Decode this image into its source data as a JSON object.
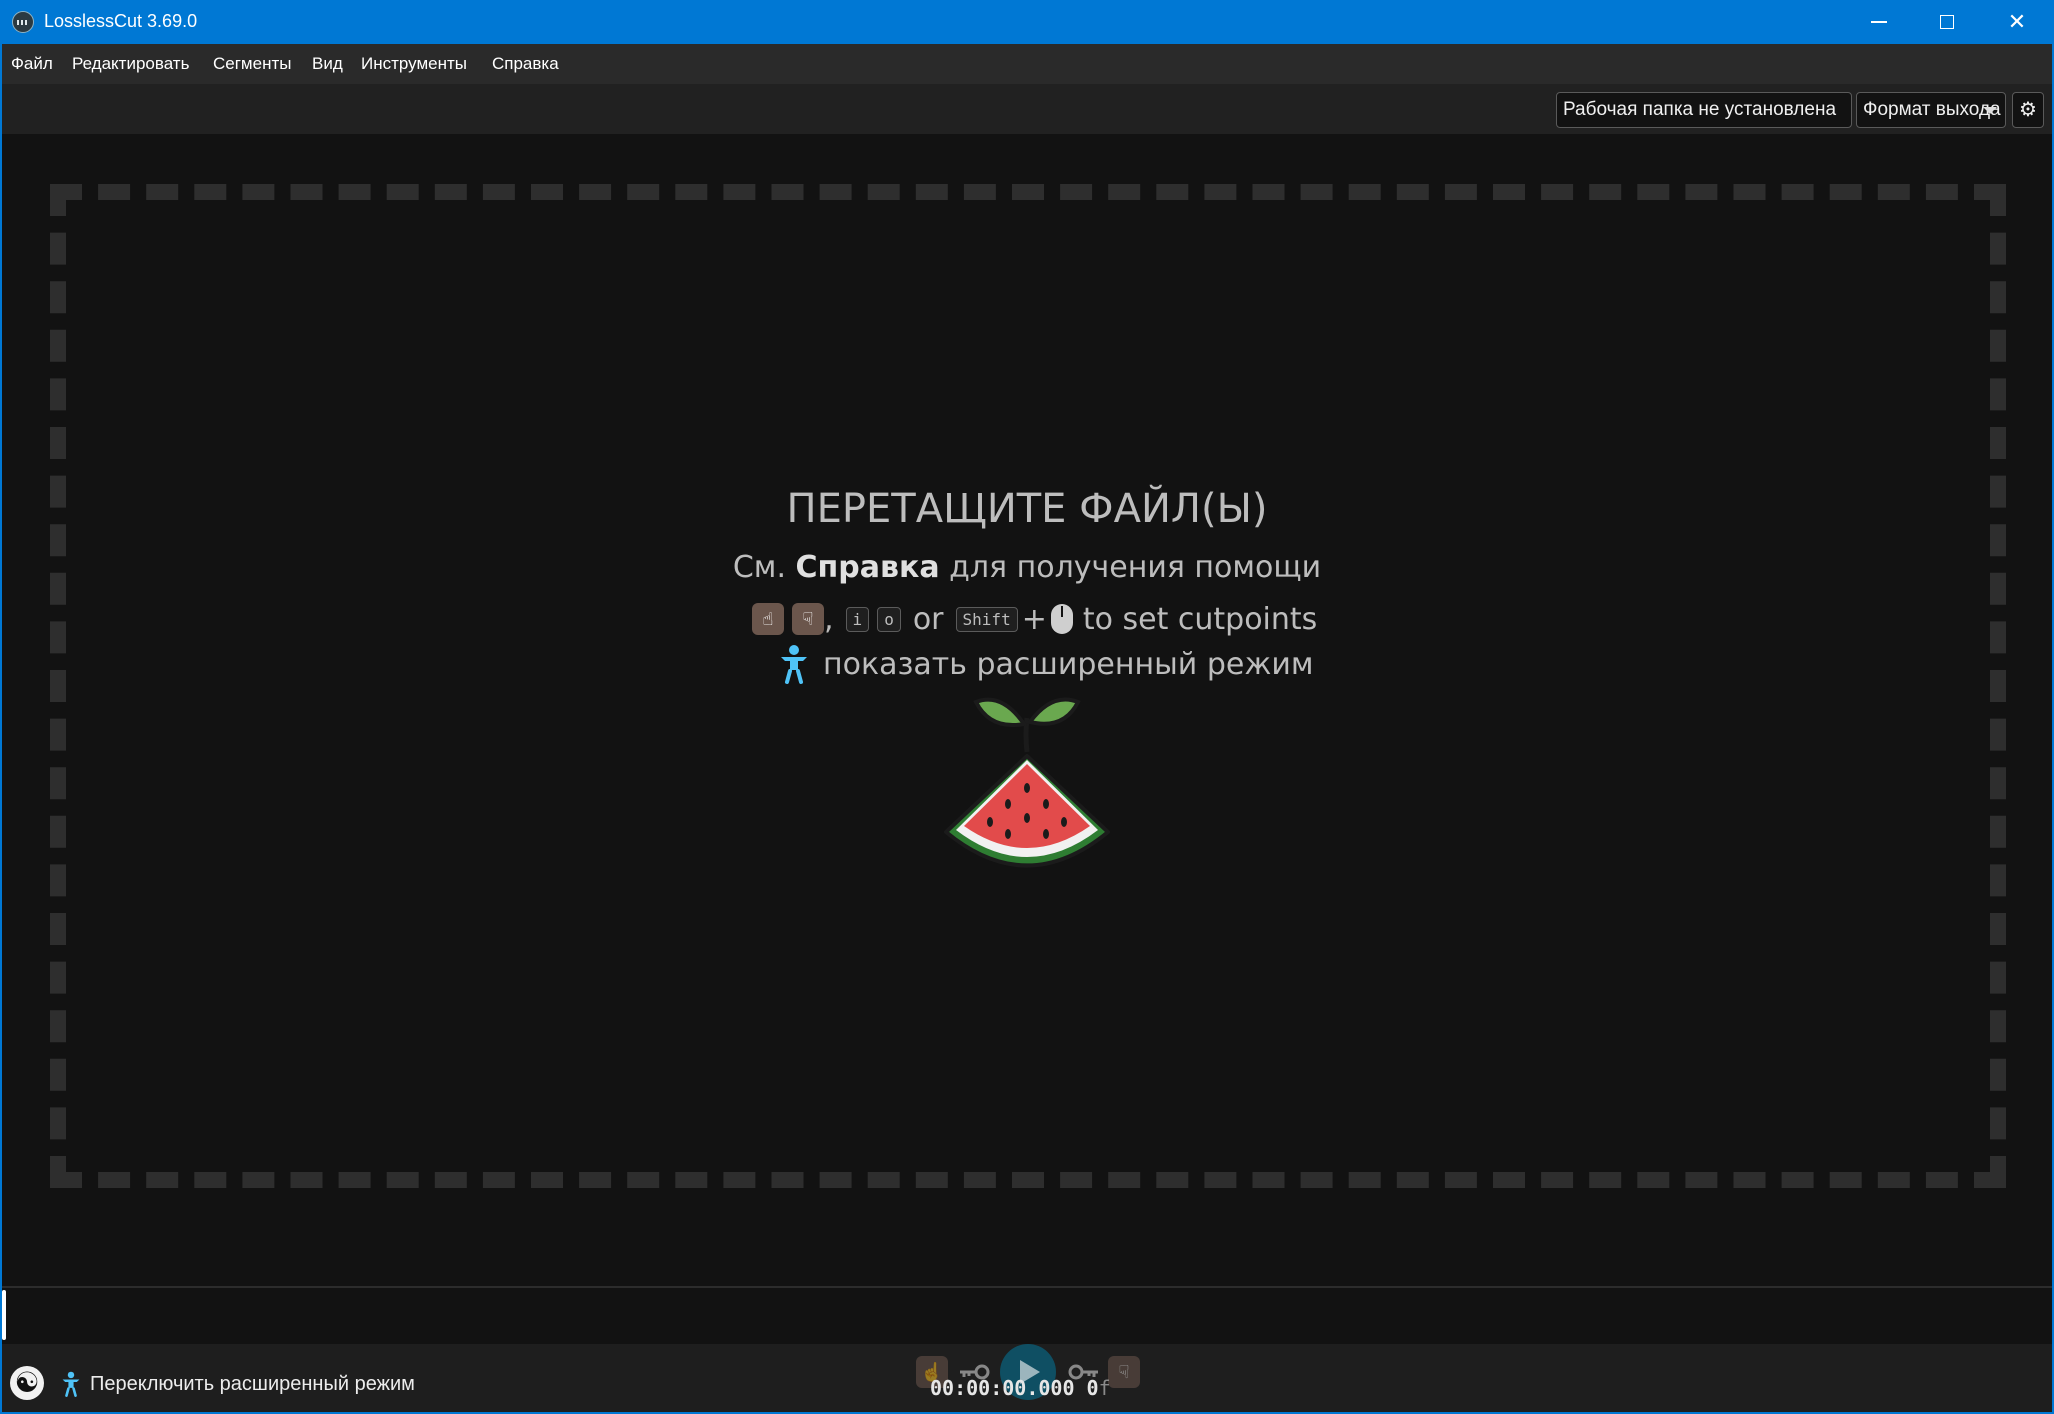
{
  "window": {
    "title": "LosslessCut 3.69.0"
  },
  "menu": {
    "items": [
      "Файл",
      "Редактировать",
      "Сегменты",
      "Вид",
      "Инструменты",
      "Справка"
    ]
  },
  "toolbar": {
    "working_dir_label": "Рабочая папка не установлена",
    "output_format_label": "Формат выхода",
    "settings_icon": "gear-icon"
  },
  "dropzone": {
    "title": "ПЕРЕТАЩИТЕ ФАЙЛ(Ы)",
    "help_prefix": "См.",
    "help_bold": "Справка",
    "help_suffix": "для получения помощи",
    "cut_separator": ",",
    "cut_key_in": "i",
    "cut_key_out": "o",
    "cut_or": "or",
    "cut_key_shift": "Shift",
    "cut_plus": "+",
    "cut_text": "to set cutpoints",
    "advanced_mode_text": "показать расширенный режим"
  },
  "bottom": {
    "toggle_advanced_label": "Переключить расширенный режим",
    "timecode": "00:00:00.000",
    "frame_count": "0",
    "frame_suffix": "f"
  },
  "colors": {
    "titlebar": "#0078d4",
    "background": "#121212",
    "menubar": "#2a2a2a",
    "accent_teal": "#4fc3f7",
    "play_button": "#0f4f63"
  }
}
